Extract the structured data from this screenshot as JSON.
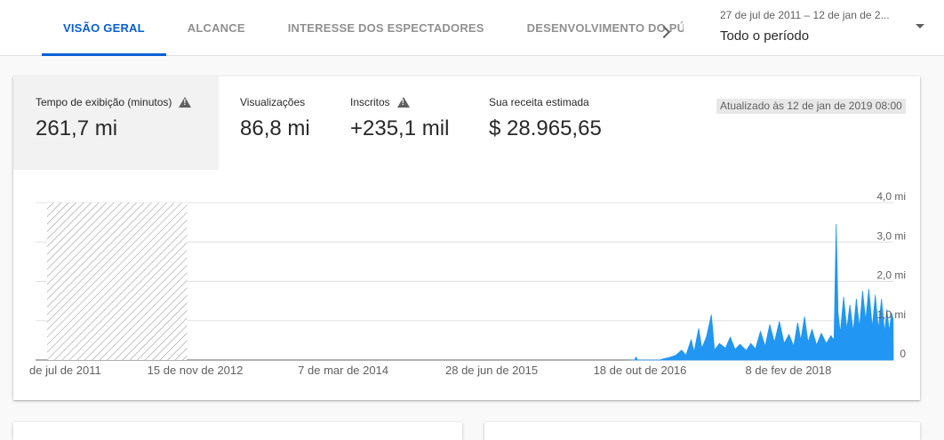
{
  "tabs": [
    {
      "label": "VISÃO GERAL",
      "active": true
    },
    {
      "label": "ALCANCE",
      "active": false
    },
    {
      "label": "INTERESSE DOS ESPECTADORES",
      "active": false
    },
    {
      "label": "DESENVOLVIMENTO DO PÚBL",
      "active": false
    }
  ],
  "period": {
    "range": "27 de jul de 2011 – 12 de jan de 2...",
    "label": "Todo o período"
  },
  "metrics": [
    {
      "label": "Tempo de exibição (minutos)",
      "value": "261,7 mi",
      "warning": true,
      "selected": true
    },
    {
      "label": "Visualizações",
      "value": "86,8 mi",
      "warning": false,
      "selected": false
    },
    {
      "label": "Inscritos",
      "value": "+235,1 mil",
      "warning": true,
      "selected": false
    },
    {
      "label": "Sua receita estimada",
      "value": "$ 28.965,65",
      "warning": false,
      "selected": false
    }
  ],
  "updated": "Atualizado às 12 de jan de 2019 08:00",
  "colors": {
    "accent": "#065fd4",
    "series": "#2196f3"
  },
  "chart_data": {
    "type": "area",
    "ytick_labels": [
      "0",
      "1,0 mi",
      "2,0 mi",
      "3,0 mi",
      "4,0 mi"
    ],
    "yticks": [
      0,
      1000000,
      2000000,
      3000000,
      4000000
    ],
    "ylim": [
      0,
      4000000
    ],
    "xtick_labels": [
      "de jul de 2011",
      "15 de nov de 2012",
      "7 de mar de 2014",
      "28 de jun de 2015",
      "18 de out de 2016",
      "8 de fev de 2018"
    ],
    "xticks": [
      "2011-07-27",
      "2012-11-15",
      "2014-03-07",
      "2015-06-28",
      "2016-10-18",
      "2018-02-08"
    ],
    "xlim": [
      "2011-06-20",
      "2019-01-12"
    ],
    "no_data_range": [
      "2011-07-27",
      "2012-10-20"
    ],
    "grid": true,
    "series": [
      {
        "points": [
          [
            "2016-09-15",
            0
          ],
          [
            "2016-10-01",
            0
          ],
          [
            "2016-10-05",
            80000
          ],
          [
            "2016-10-10",
            0
          ],
          [
            "2016-12-20",
            0
          ],
          [
            "2017-01-01",
            30000
          ],
          [
            "2017-01-20",
            60000
          ],
          [
            "2017-02-10",
            120000
          ],
          [
            "2017-03-01",
            250000
          ],
          [
            "2017-03-15",
            120000
          ],
          [
            "2017-04-01",
            520000
          ],
          [
            "2017-04-10",
            200000
          ],
          [
            "2017-04-25",
            800000
          ],
          [
            "2017-05-05",
            300000
          ],
          [
            "2017-05-20",
            580000
          ],
          [
            "2017-06-05",
            1150000
          ],
          [
            "2017-06-15",
            250000
          ],
          [
            "2017-07-01",
            420000
          ],
          [
            "2017-07-20",
            300000
          ],
          [
            "2017-08-05",
            580000
          ],
          [
            "2017-08-20",
            270000
          ],
          [
            "2017-09-05",
            400000
          ],
          [
            "2017-09-25",
            240000
          ],
          [
            "2017-10-10",
            420000
          ],
          [
            "2017-10-25",
            280000
          ],
          [
            "2017-11-10",
            730000
          ],
          [
            "2017-11-25",
            350000
          ],
          [
            "2017-12-10",
            900000
          ],
          [
            "2017-12-25",
            450000
          ],
          [
            "2018-01-10",
            980000
          ],
          [
            "2018-01-25",
            420000
          ],
          [
            "2018-02-10",
            650000
          ],
          [
            "2018-02-25",
            350000
          ],
          [
            "2018-03-10",
            950000
          ],
          [
            "2018-03-20",
            500000
          ],
          [
            "2018-04-01",
            1100000
          ],
          [
            "2018-04-12",
            450000
          ],
          [
            "2018-04-25",
            780000
          ],
          [
            "2018-05-10",
            380000
          ],
          [
            "2018-05-25",
            680000
          ],
          [
            "2018-06-10",
            420000
          ],
          [
            "2018-06-25",
            620000
          ],
          [
            "2018-07-05",
            500000
          ],
          [
            "2018-07-12",
            3450000
          ],
          [
            "2018-07-18",
            1200000
          ],
          [
            "2018-07-25",
            680000
          ],
          [
            "2018-08-05",
            1600000
          ],
          [
            "2018-08-15",
            780000
          ],
          [
            "2018-08-25",
            1400000
          ],
          [
            "2018-09-05",
            720000
          ],
          [
            "2018-09-15",
            1550000
          ],
          [
            "2018-09-25",
            820000
          ],
          [
            "2018-10-05",
            1750000
          ],
          [
            "2018-10-15",
            1000000
          ],
          [
            "2018-10-25",
            1800000
          ],
          [
            "2018-11-05",
            820000
          ],
          [
            "2018-11-15",
            1650000
          ],
          [
            "2018-11-25",
            780000
          ],
          [
            "2018-12-05",
            1550000
          ],
          [
            "2018-12-15",
            700000
          ],
          [
            "2018-12-22",
            1280000
          ],
          [
            "2018-12-30",
            720000
          ],
          [
            "2019-01-06",
            1200000
          ],
          [
            "2019-01-11",
            1050000
          ],
          [
            "2019-01-12",
            0
          ]
        ]
      }
    ]
  }
}
